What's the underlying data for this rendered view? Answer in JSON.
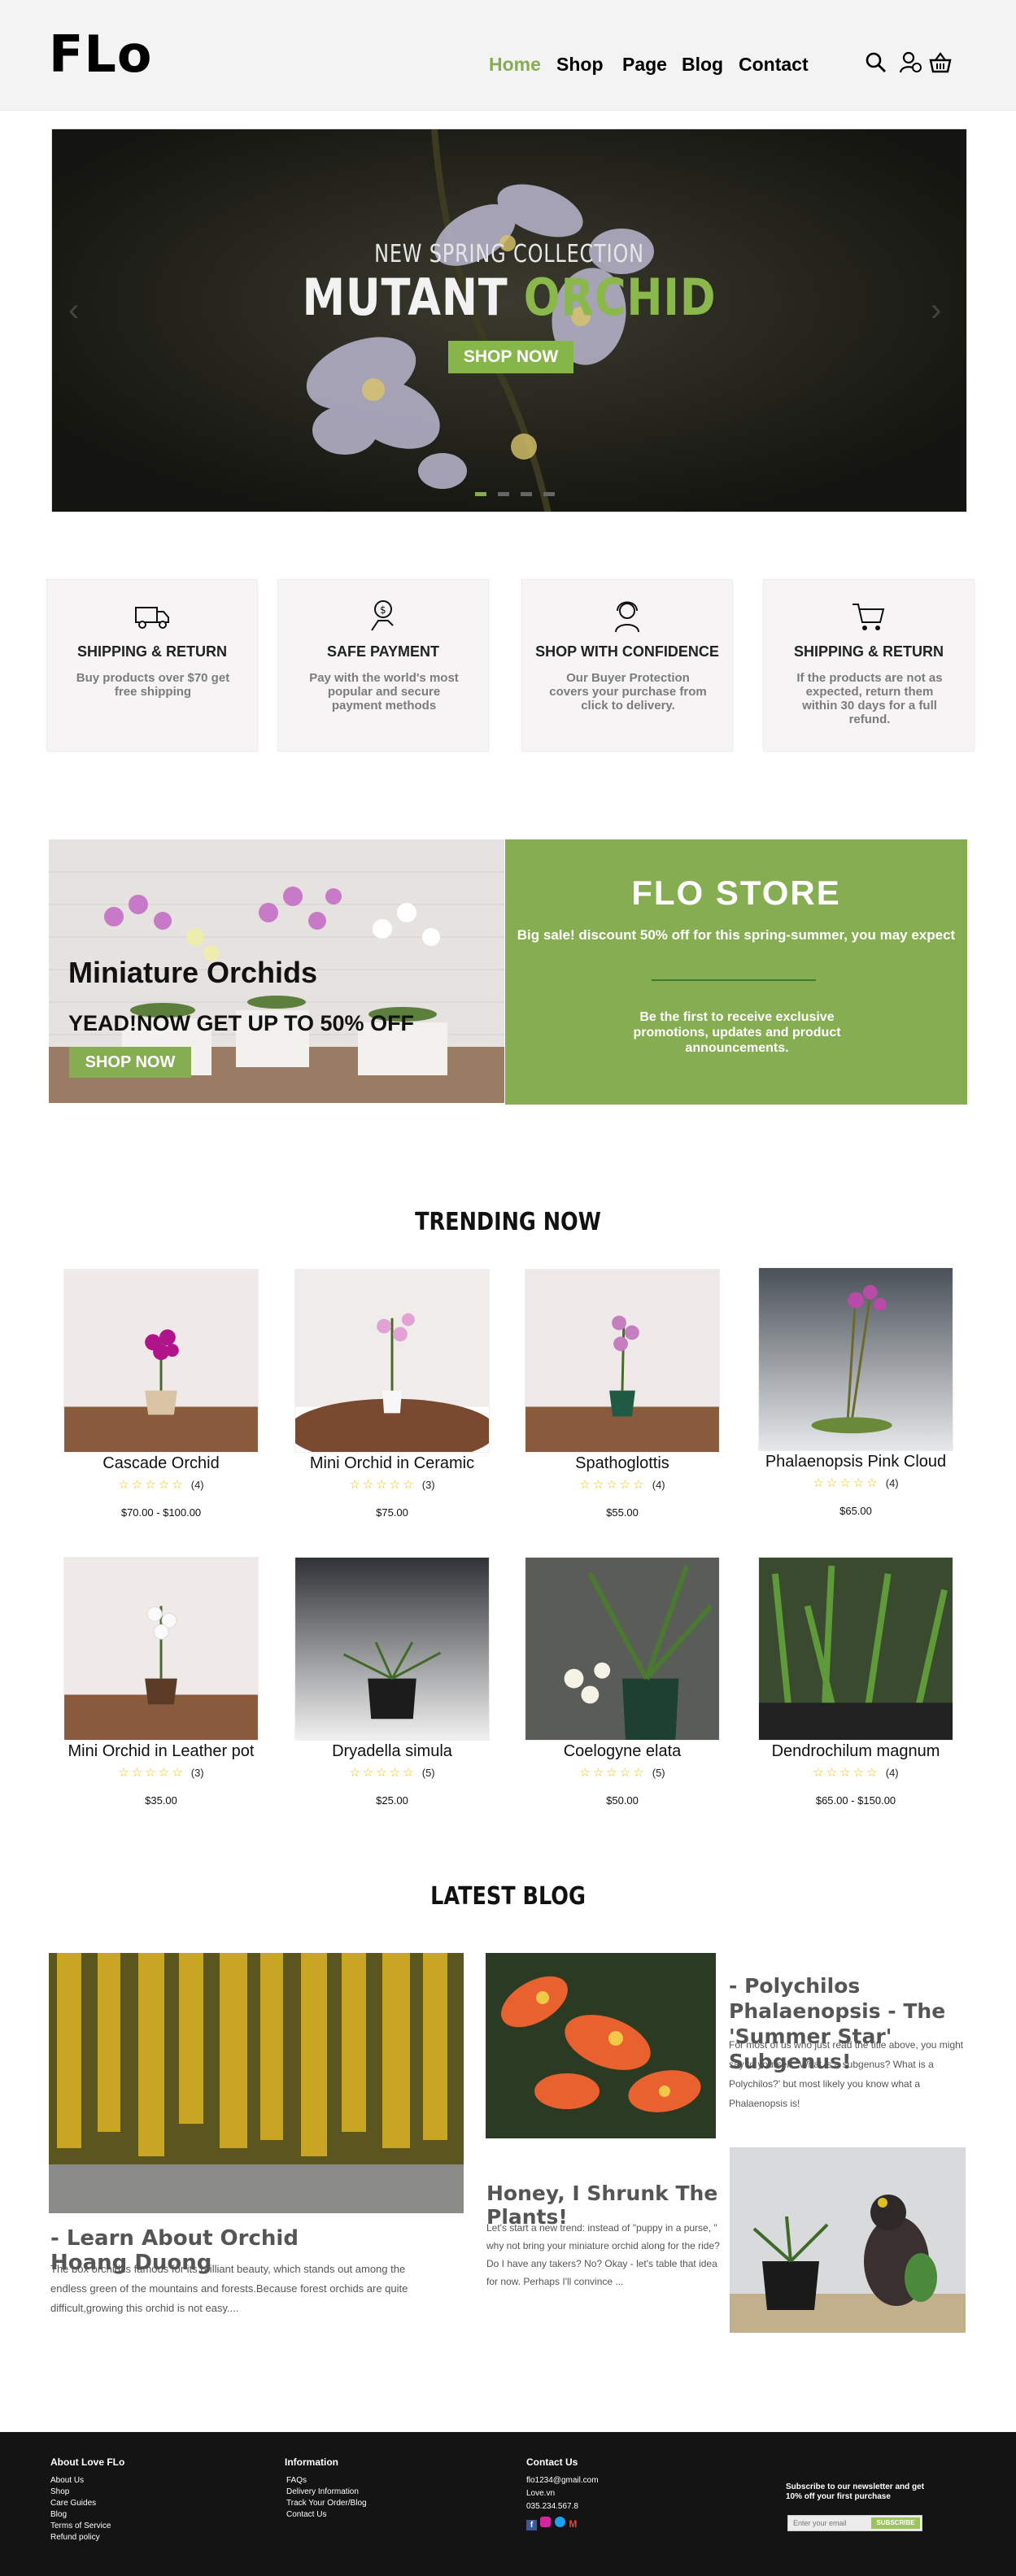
{
  "header": {
    "logo": "FLo",
    "nav": [
      "Home",
      "Shop",
      "Page",
      "Blog",
      "Contact"
    ]
  },
  "hero": {
    "subtitle": "NEW SPRING COLLECTION",
    "title_main": "MUTANT",
    "title_accent": "ORCHID",
    "button": "SHOP NOW",
    "slides": 4,
    "active_slide": 1
  },
  "features": [
    {
      "icon": "truck-icon",
      "title": "SHIPPING & RETURN",
      "desc": "Buy products over $70 get free shipping"
    },
    {
      "icon": "payment-icon",
      "title": "SAFE PAYMENT",
      "desc": "Pay with the world's most popular and secure payment methods"
    },
    {
      "icon": "support-agent-icon",
      "title": "SHOP WITH CONFIDENCE",
      "desc": "Our Buyer Protection covers your purchase from click to delivery."
    },
    {
      "icon": "cart-icon",
      "title": "SHIPPING & RETURN",
      "desc": "If the products are not as expected, return them within 30 days for a full refund."
    }
  ],
  "promo": {
    "title": "Miniature Orchids",
    "subtitle": "YEAD!NOW GET UP TO 50% OFF",
    "button": "SHOP NOW",
    "store_title": "FLO  STORE",
    "store_sale": "Big sale! discount 50% off for this spring-summer, you may expect",
    "store_first": "Be the first to receive exclusive promotions, updates and product announcements."
  },
  "trending": {
    "title": "TRENDING NOW",
    "products": [
      {
        "name": "Cascade Orchid",
        "rating": 0,
        "count": "(4)",
        "price": "$70.00 - $100.00"
      },
      {
        "name": "Mini Orchid in Ceramic",
        "rating": 0,
        "count": "(3)",
        "price": "$75.00"
      },
      {
        "name": "Spathoglottis",
        "rating": 0,
        "count": "(4)",
        "price": "$55.00"
      },
      {
        "name": "Phalaenopsis Pink Cloud",
        "rating": 0,
        "count": "(4)",
        "price": "$65.00"
      },
      {
        "name": "Mini Orchid in Leather pot",
        "rating": 0,
        "count": "(3)",
        "price": "$35.00"
      },
      {
        "name": "Dryadella simula",
        "rating": 0,
        "count": "(5)",
        "price": "$25.00"
      },
      {
        "name": "Coelogyne elata",
        "rating": 0,
        "count": "(5)",
        "price": "$50.00"
      },
      {
        "name": "Dendrochilum magnum",
        "rating": 0,
        "count": "(4)",
        "price": "$65.00 - $150.00"
      }
    ]
  },
  "blog": {
    "title": "LATEST BLOG",
    "posts": [
      {
        "title": "- Learn About Orchid Hoang Duong",
        "excerpt": "The box orchid is famous for its brilliant beauty, which stands out among the endless green of the mountains and forests.Because forest orchids are quite difficult,growing this orchid is not easy...."
      },
      {
        "title": "Honey, I Shrunk The Plants!",
        "excerpt": "Let's start a new trend: instead of \"puppy in a purse, \" why not bring your miniature orchid along for the ride? Do I have any takers? No? Okay - let's table that idea for now. Perhaps I'll convince ..."
      },
      {
        "title": "- Polychilos Phalaenopsis - The 'Summer Star' Subgenus!",
        "excerpt": "For most of us who just read the title above, you might say to yourself, 'What is a subgenus? What is a Polychilos?' but most likely you know what a Phalaenopsis is!"
      }
    ]
  },
  "footer": {
    "about_title": "About Love FLo",
    "about_links": [
      "About Us",
      "Shop",
      "Care Guides",
      "Blog",
      "Terms of Service",
      "Refund policy"
    ],
    "info_title": "Information",
    "info_links": [
      "FAQs",
      "Delivery Information",
      "Track Your Order/Blog",
      "Contact Us"
    ],
    "contact_title": "Contact Us",
    "contact_lines": [
      "flo1234@gmail.com",
      "Love.vn",
      "035.234.567.8"
    ],
    "newsletter": "Subscribe to our newsletter and get 10% off your first purchase",
    "email_placeholder": "Enter your email",
    "subscribe": "SUBSCRIBE"
  }
}
